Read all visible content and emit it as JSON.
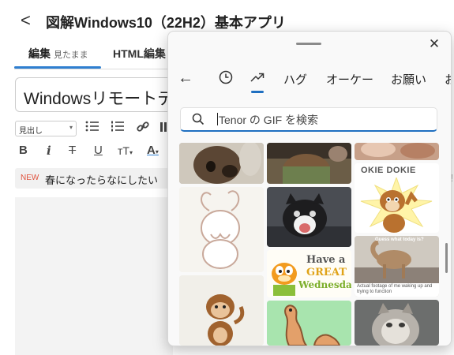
{
  "page": {
    "back_glyph": "<",
    "title": "図解Windows10（22H2）基本アプリ",
    "tabs": [
      {
        "label": "編集",
        "sub": "見たまま"
      },
      {
        "label": "HTML編集"
      }
    ],
    "title_input_value": "Windowsリモートデ",
    "style_select": "見出し",
    "notice": {
      "badge": "NEW",
      "text": "春になったらなにしたい"
    },
    "right_edge_char": "!"
  },
  "gif_panel": {
    "close_glyph": "✕",
    "nav": {
      "back_glyph": "←",
      "categories": [
        "ハグ",
        "オーケー",
        "お願い",
        "お"
      ]
    },
    "search": {
      "placeholder": "Tenor の GIF を検索"
    },
    "captions": {
      "okie": "OKIE DOKIE",
      "wed_1": "Have a",
      "wed_2": "GREAT",
      "wed_3": "Wednesday!",
      "camel_top": "Guess what today is?",
      "camel_bottom": "Actual footage of me waking up and trying to function"
    }
  },
  "colors": {
    "accent": "#1f6fc0",
    "tab_underline": "#2f7fd0",
    "new_badge": "#e0533e"
  },
  "icons": [
    "back-arrow-icon",
    "close-icon",
    "recent-clock-icon",
    "trending-arrow-icon",
    "search-icon",
    "bullet-list-icon",
    "numbered-list-icon",
    "link-icon",
    "bold-icon",
    "italic-icon",
    "strikethrough-icon",
    "underline-icon",
    "text-size-icon",
    "font-color-icon"
  ]
}
